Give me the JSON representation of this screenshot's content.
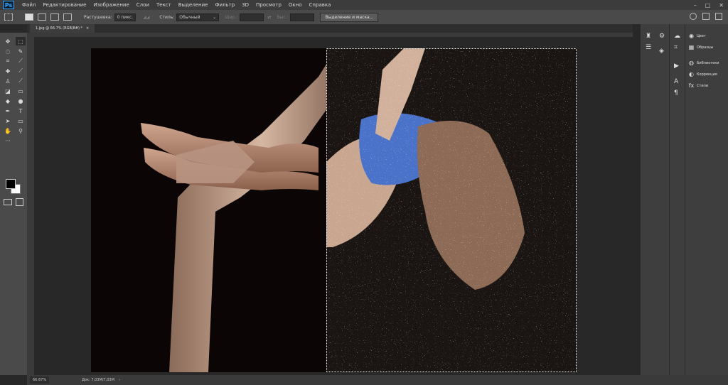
{
  "app": {
    "logo": "Ps"
  },
  "menu": [
    "Файл",
    "Редактирование",
    "Изображение",
    "Слои",
    "Текст",
    "Выделение",
    "Фильтр",
    "3D",
    "Просмотр",
    "Окно",
    "Справка"
  ],
  "window_controls": [
    "–",
    "□",
    "✕"
  ],
  "options_bar": {
    "feather_label": "Растушевка:",
    "feather_value": "0 пикс.",
    "style_label": "Стиль:",
    "style_value": "Обычный",
    "width_label": "Шир.:",
    "height_label": "Выс.:",
    "mask_button": "Выделение и маска..."
  },
  "document_tab": {
    "title": "1.jpg @ 66.7% (RGB/8#) *",
    "close": "×"
  },
  "status": {
    "zoom": "66.67%",
    "doc_info": "Док: 7,03M/7,03M"
  },
  "dock_panels": [
    {
      "label": "Цвет",
      "icon": "color-wheel-icon"
    },
    {
      "label": "Образцы",
      "icon": "swatches-icon"
    },
    {
      "label": "Библиотеки",
      "icon": "libraries-icon"
    },
    {
      "label": "Коррекция",
      "icon": "adjustments-icon"
    },
    {
      "label": "Стили",
      "icon": "styles-icon"
    }
  ],
  "colors": {
    "foreground": "#000000",
    "background": "#ffffff",
    "accent": "#31a8ff"
  }
}
